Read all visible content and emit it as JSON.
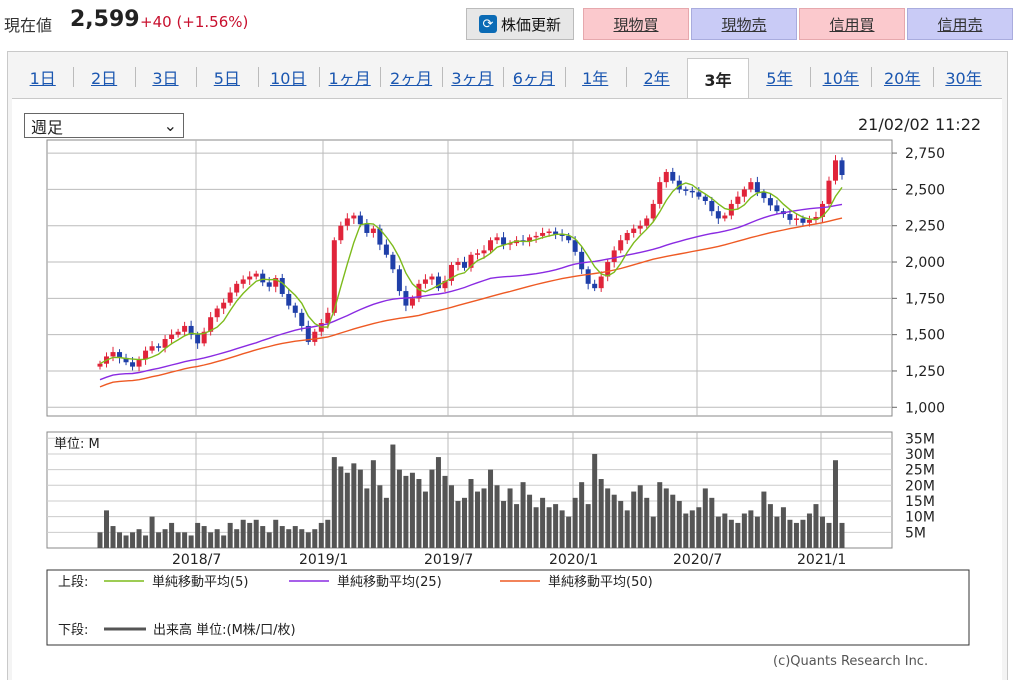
{
  "header": {
    "price_label": "現在値",
    "price": "2,599",
    "change": "+40",
    "change_pct": "(+1.56%)",
    "refresh_label": "株価更新",
    "trade_buttons": [
      "現物買",
      "現物売",
      "信用買",
      "信用売"
    ],
    "colors": {
      "buy_bg": "#fbc9cd",
      "sell_bg": "#c9cbf6",
      "change": "#c8102e"
    }
  },
  "tabs": [
    "1日",
    "2日",
    "3日",
    "5日",
    "10日",
    "1ヶ月",
    "2ヶ月",
    "3ヶ月",
    "6ヶ月",
    "1年",
    "2年",
    "3年",
    "5年",
    "10年",
    "20年",
    "30年"
  ],
  "active_tab": "3年",
  "period_select": "週足",
  "timestamp": "21/02/02 11:22",
  "copyright": "(c)Quants Research Inc.",
  "chart_data": [
    {
      "type": "candlestick",
      "title": "",
      "y_ticks": [
        "2,750",
        "2,500",
        "2,250",
        "2,000",
        "1,750",
        "1,500",
        "1,250",
        "1,000"
      ],
      "ylim": [
        1000,
        2800
      ],
      "x_ticks": [
        "2018/7",
        "2019/1",
        "2019/7",
        "2020/1",
        "2020/7",
        "2021/1"
      ],
      "close_series": [
        1300,
        1350,
        1380,
        1340,
        1310,
        1280,
        1330,
        1390,
        1420,
        1410,
        1470,
        1500,
        1520,
        1560,
        1500,
        1440,
        1520,
        1620,
        1680,
        1720,
        1790,
        1850,
        1880,
        1900,
        1920,
        1860,
        1830,
        1890,
        1780,
        1700,
        1650,
        1560,
        1450,
        1520,
        1580,
        1650,
        2150,
        2250,
        2300,
        2320,
        2260,
        2200,
        2230,
        2120,
        2050,
        1950,
        1800,
        1700,
        1750,
        1850,
        1880,
        1900,
        1820,
        1870,
        1980,
        2000,
        1960,
        2050,
        2060,
        2080,
        2150,
        2170,
        2120,
        2130,
        2150,
        2140,
        2170,
        2180,
        2200,
        2210,
        2190,
        2180,
        2150,
        2070,
        1950,
        1850,
        1820,
        1900,
        2000,
        2080,
        2150,
        2200,
        2230,
        2250,
        2300,
        2400,
        2550,
        2620,
        2560,
        2500,
        2490,
        2480,
        2450,
        2420,
        2350,
        2300,
        2320,
        2400,
        2450,
        2500,
        2550,
        2480,
        2440,
        2390,
        2350,
        2330,
        2290,
        2300,
        2270,
        2290,
        2310,
        2400,
        2560,
        2700,
        2599
      ],
      "series": [
        {
          "name": "単純移動平均(5)",
          "color": "#7dbb1c"
        },
        {
          "name": "単純移動平均(25)",
          "color": "#8a2be2",
          "start": 1100,
          "end": 2380
        },
        {
          "name": "単純移動平均(50)",
          "color": "#ee5a24",
          "start": 1010,
          "end": 2300
        }
      ],
      "legend_title": "上段:"
    },
    {
      "type": "bar",
      "unit_label": "単位: M",
      "y_ticks": [
        "35M",
        "30M",
        "25M",
        "20M",
        "15M",
        "10M",
        "5M"
      ],
      "ylim": [
        0,
        35
      ],
      "values": [
        5,
        12,
        7,
        5,
        4,
        5,
        6,
        4,
        10,
        5,
        6,
        8,
        5,
        5,
        4,
        8,
        7,
        5,
        6,
        4,
        8,
        6,
        9,
        8,
        9,
        7,
        5,
        9,
        7,
        6,
        7,
        6,
        5,
        6,
        8,
        9,
        29,
        26,
        24,
        27,
        25,
        19,
        28,
        20,
        16,
        33,
        25,
        23,
        24,
        22,
        18,
        25,
        29,
        23,
        20,
        15,
        16,
        22,
        18,
        19,
        25,
        20,
        15,
        19,
        14,
        21,
        17,
        13,
        16,
        13,
        14,
        12,
        10,
        16,
        21,
        14,
        30,
        22,
        19,
        17,
        15,
        12,
        18,
        20,
        16,
        10,
        21,
        19,
        17,
        15,
        11,
        12,
        13,
        19,
        16,
        10,
        11,
        9,
        8,
        11,
        12,
        10,
        18,
        14,
        10,
        13,
        9,
        8,
        9,
        11,
        14,
        10,
        8,
        28,
        8
      ],
      "series": [
        {
          "name": "出来高 単位:(M株/口/枚)",
          "color": "#555555"
        }
      ],
      "legend_title": "下段:"
    }
  ]
}
